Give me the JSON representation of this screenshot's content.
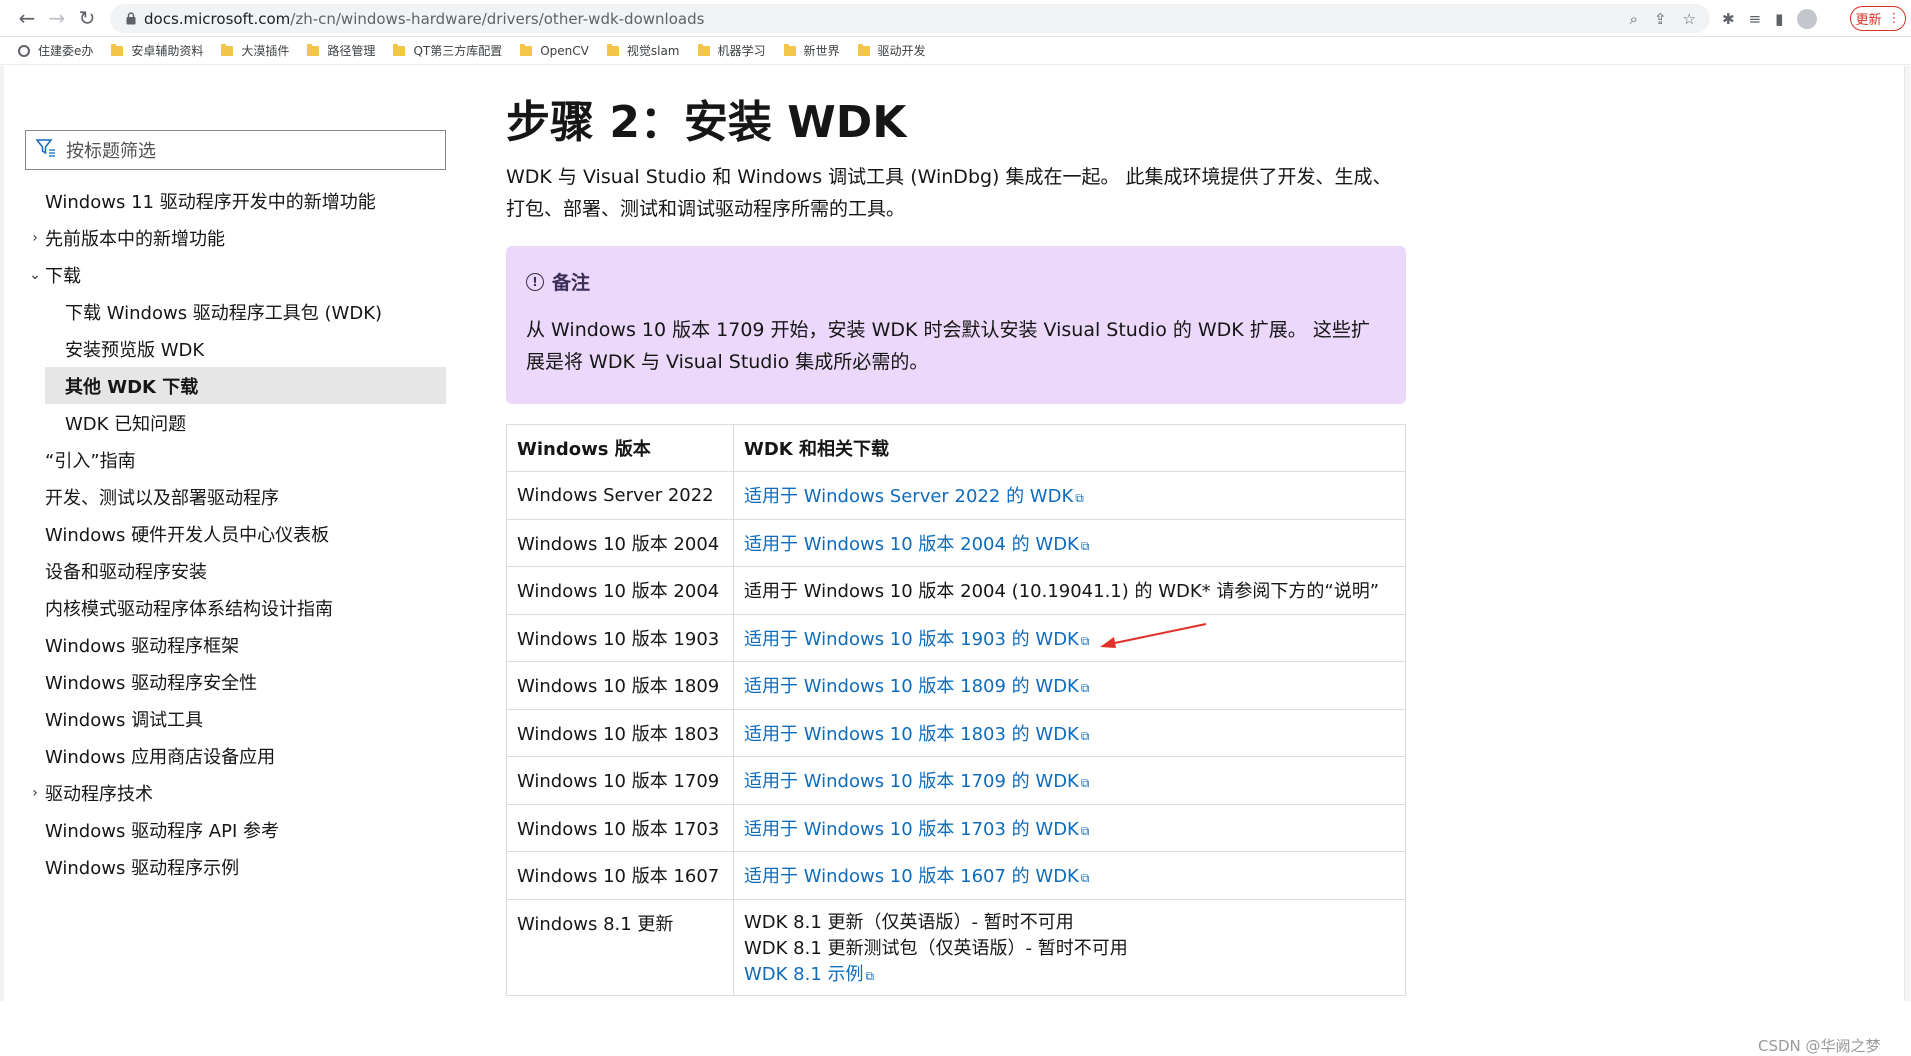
{
  "browser": {
    "url_host": "docs.microsoft.com",
    "url_path": "/zh-cn/windows-hardware/drivers/other-wdk-downloads",
    "update_label": "更新"
  },
  "bookmarks": [
    "住建委e办",
    "安卓辅助资料",
    "大漠插件",
    "路径管理",
    "QT第三方库配置",
    "OpenCV",
    "视觉slam",
    "机器学习",
    "新世界",
    "驱动开发"
  ],
  "sidebar": {
    "filter_placeholder": "按标题筛选",
    "items": [
      {
        "label": "Windows 11 驱动程序开发中的新增功能"
      },
      {
        "label": "先前版本中的新增功能"
      },
      {
        "label": "下载"
      },
      {
        "label": "下载 Windows 驱动程序工具包 (WDK)"
      },
      {
        "label": "安装预览版 WDK"
      },
      {
        "label": "其他 WDK 下载"
      },
      {
        "label": "WDK 已知问题"
      },
      {
        "label": "“引入”指南"
      },
      {
        "label": "开发、测试以及部署驱动程序"
      },
      {
        "label": "Windows 硬件开发人员中心仪表板"
      },
      {
        "label": "设备和驱动程序安装"
      },
      {
        "label": "内核模式驱动程序体系结构设计指南"
      },
      {
        "label": "Windows 驱动程序框架"
      },
      {
        "label": "Windows 驱动程序安全性"
      },
      {
        "label": "Windows 调试工具"
      },
      {
        "label": "Windows 应用商店设备应用"
      },
      {
        "label": "驱动程序技术"
      },
      {
        "label": "Windows 驱动程序 API 参考"
      },
      {
        "label": "Windows 驱动程序示例"
      }
    ]
  },
  "main": {
    "title": "步骤 2：安装 WDK",
    "intro": "WDK 与 Visual Studio 和 Windows 调试工具 (WinDbg) 集成在一起。 此集成环境提供了开发、生成、打包、部署、测试和调试驱动程序所需的工具。",
    "note_title": "备注",
    "note_body": "从 Windows 10 版本 1709 开始，安装 WDK 时会默认安装 Visual Studio 的 WDK 扩展。 这些扩展是将 WDK 与 Visual Studio 集成所必需的。"
  },
  "table": {
    "headers": [
      "Windows 版本",
      "WDK 和相关下载"
    ],
    "rows": [
      {
        "version": "Windows Server 2022",
        "download": "适用于 Windows Server 2022 的 WDK"
      },
      {
        "version": "Windows 10 版本 2004",
        "download": "适用于 Windows 10 版本 2004 的 WDK"
      },
      {
        "version": "Windows 10 版本 2004",
        "download": "适用于 Windows 10 版本 2004 (10.19041.1) 的 WDK* 请参阅下方的“说明”"
      },
      {
        "version": "Windows 10 版本 1903",
        "download": "适用于 Windows 10 版本 1903 的 WDK"
      },
      {
        "version": "Windows 10 版本 1809",
        "download": "适用于 Windows 10 版本 1809 的 WDK"
      },
      {
        "version": "Windows 10 版本 1803",
        "download": "适用于 Windows 10 版本 1803 的 WDK"
      },
      {
        "version": "Windows 10 版本 1709",
        "download": "适用于 Windows 10 版本 1709 的 WDK"
      },
      {
        "version": "Windows 10 版本 1703",
        "download": "适用于 Windows 10 版本 1703 的 WDK"
      },
      {
        "version": "Windows 10 版本 1607",
        "download": "适用于 Windows 10 版本 1607 的 WDK"
      }
    ],
    "last_row": {
      "version": "Windows 8.1 更新",
      "line1": "WDK 8.1 更新（仅英语版）- 暂时不可用",
      "line2": "WDK 8.1 更新测试包（仅英语版）- 暂时不可用",
      "line3": "WDK 8.1 示例"
    }
  },
  "watermark": "CSDN @华阙之梦",
  "colors": {
    "link": "#0f6cbd",
    "note_bg": "#ebd8fa",
    "arrow": "#e0312b"
  }
}
